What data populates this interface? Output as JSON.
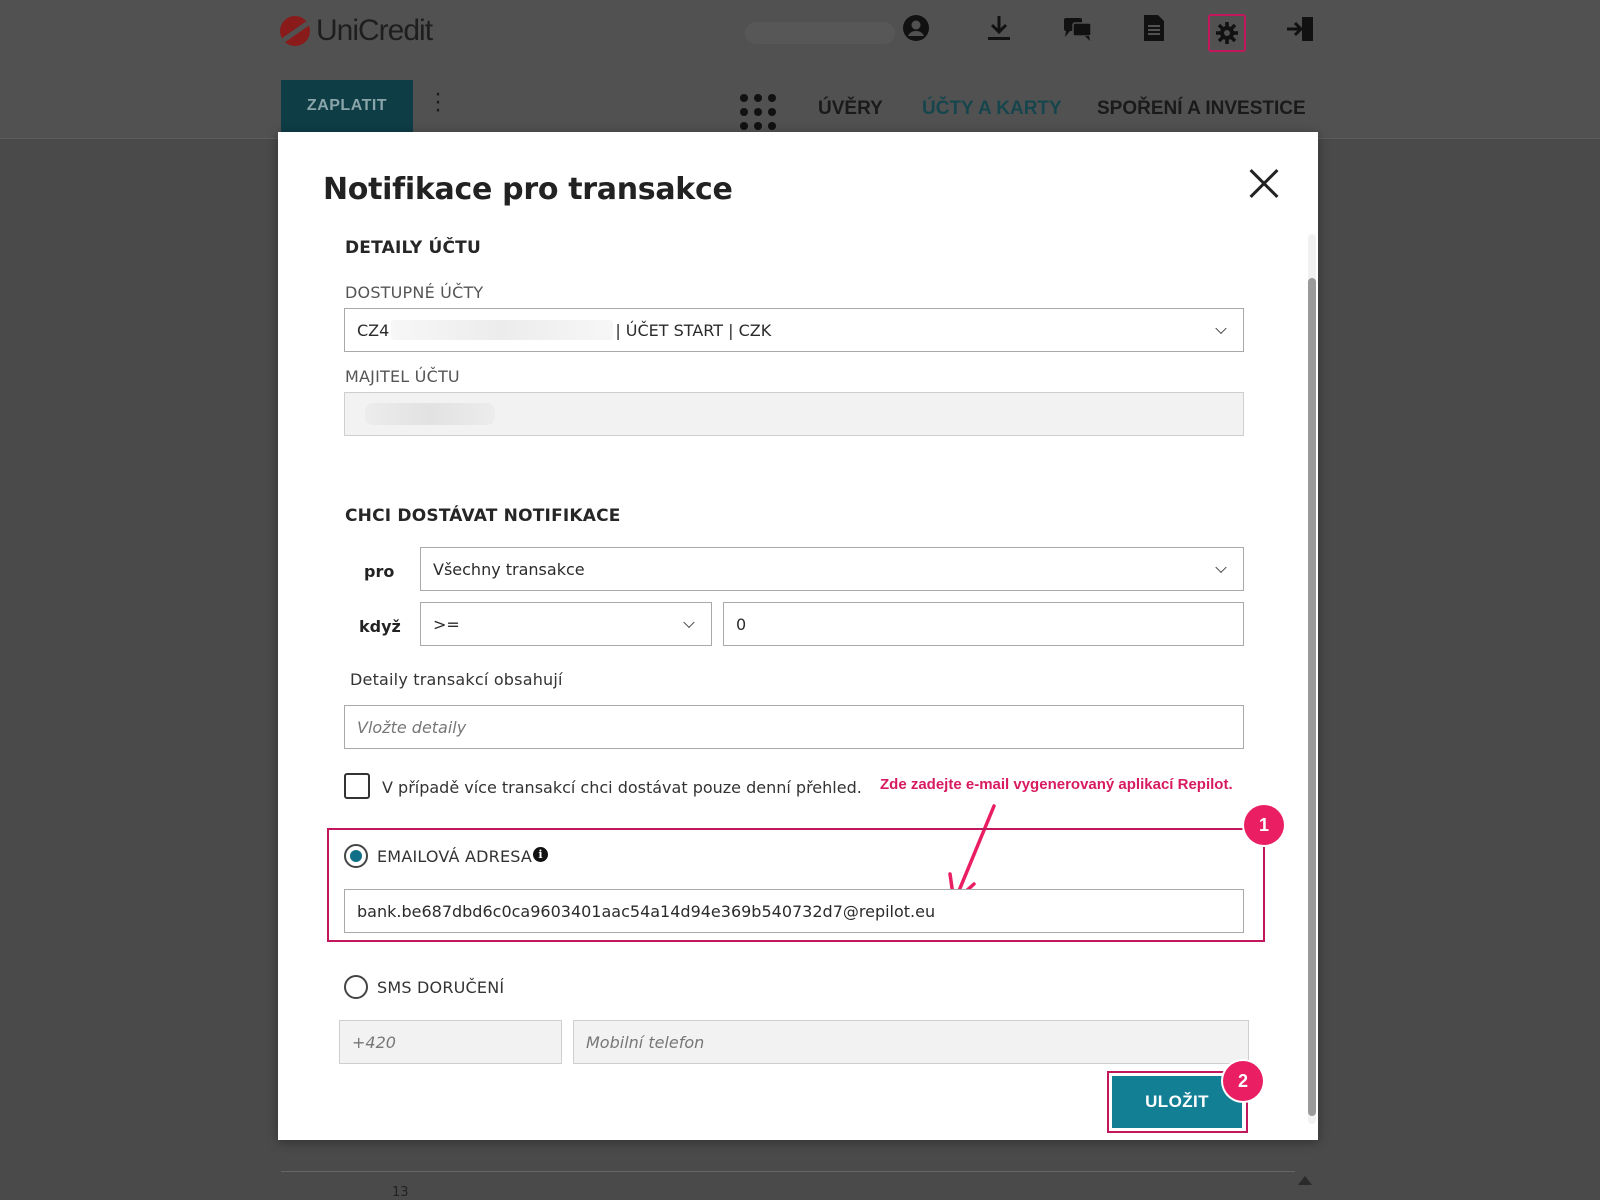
{
  "header": {
    "brand": "UniCredit",
    "pay_button": "ZAPLATIT",
    "nav": [
      "ÚVĚRY",
      "ÚČTY A KARTY",
      "SPOŘENÍ A INVESTICE"
    ],
    "icons": [
      "user-icon",
      "download-icon",
      "chat-icon",
      "document-icon",
      "settings-icon",
      "logout-icon"
    ]
  },
  "background_table": {
    "row_number": "13"
  },
  "modal": {
    "title": "Notifikace pro transakce",
    "account_section": {
      "heading": "DETAILY ÚČTU",
      "accounts_label": "DOSTUPNÉ ÚČTY",
      "account_prefix": "CZ4",
      "account_suffix": "| ÚČET START | CZK",
      "owner_label": "MAJITEL ÚČTU"
    },
    "notify_section": {
      "heading": "CHCI DOSTÁVAT NOTIFIKACE",
      "for_label": "pro",
      "for_value": "Všechny transakce",
      "when_label": "když",
      "operator_value": ">=",
      "amount_value": "0",
      "details_label": "Detaily transakcí obsahují",
      "details_placeholder": "Vložte detaily",
      "daily_summary_label": "V případě více transakcí chci dostávat pouze denní přehled."
    },
    "email": {
      "label": "EMAILOVÁ ADRESA",
      "value": "bank.be687dbd6c0ca9603401aac54a14d94e369b540732d7@repilot.eu"
    },
    "sms": {
      "label": "SMS DORUČENÍ",
      "prefix_placeholder": "+420",
      "phone_placeholder": "Mobilní telefon"
    },
    "save_button": "ULOŽIT"
  },
  "annotations": {
    "email_hint": "Zde zadejte e-mail vygenerovaný aplikací Repilot.",
    "badge_1": "1",
    "badge_2": "2",
    "accent_color": "#e91e63"
  },
  "colors": {
    "primary_button": "#137f95",
    "overlay": "#4a4a4a",
    "highlight": "#c2185b"
  }
}
